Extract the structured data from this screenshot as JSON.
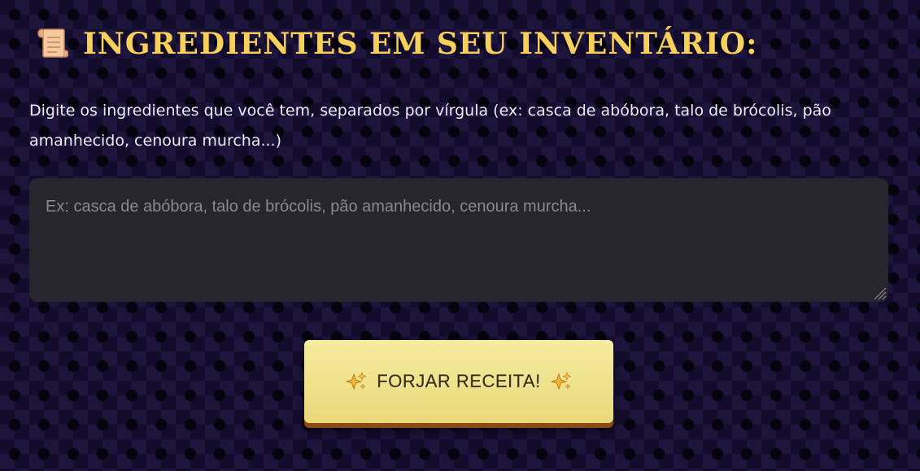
{
  "section": {
    "title": "INGREDIENTES EM SEU INVENTÁRIO:",
    "title_icon": "scroll-icon",
    "instructions": "Digite os ingredientes que você tem, separados por vírgula (ex: casca de abóbora, talo de brócolis, pão amanhecido, cenoura murcha...)"
  },
  "input": {
    "value": "",
    "placeholder": "Ex: casca de abóbora, talo de brócolis, pão amanhecido, cenoura murcha..."
  },
  "action": {
    "label": "FORJAR RECEITA!",
    "icon": "sparkles-icon"
  },
  "colors": {
    "background": "#130c2c",
    "title": "#f6d05a",
    "input_background": "#27262f",
    "button": "#f0e28c",
    "button_shadow": "#8a4b16"
  }
}
